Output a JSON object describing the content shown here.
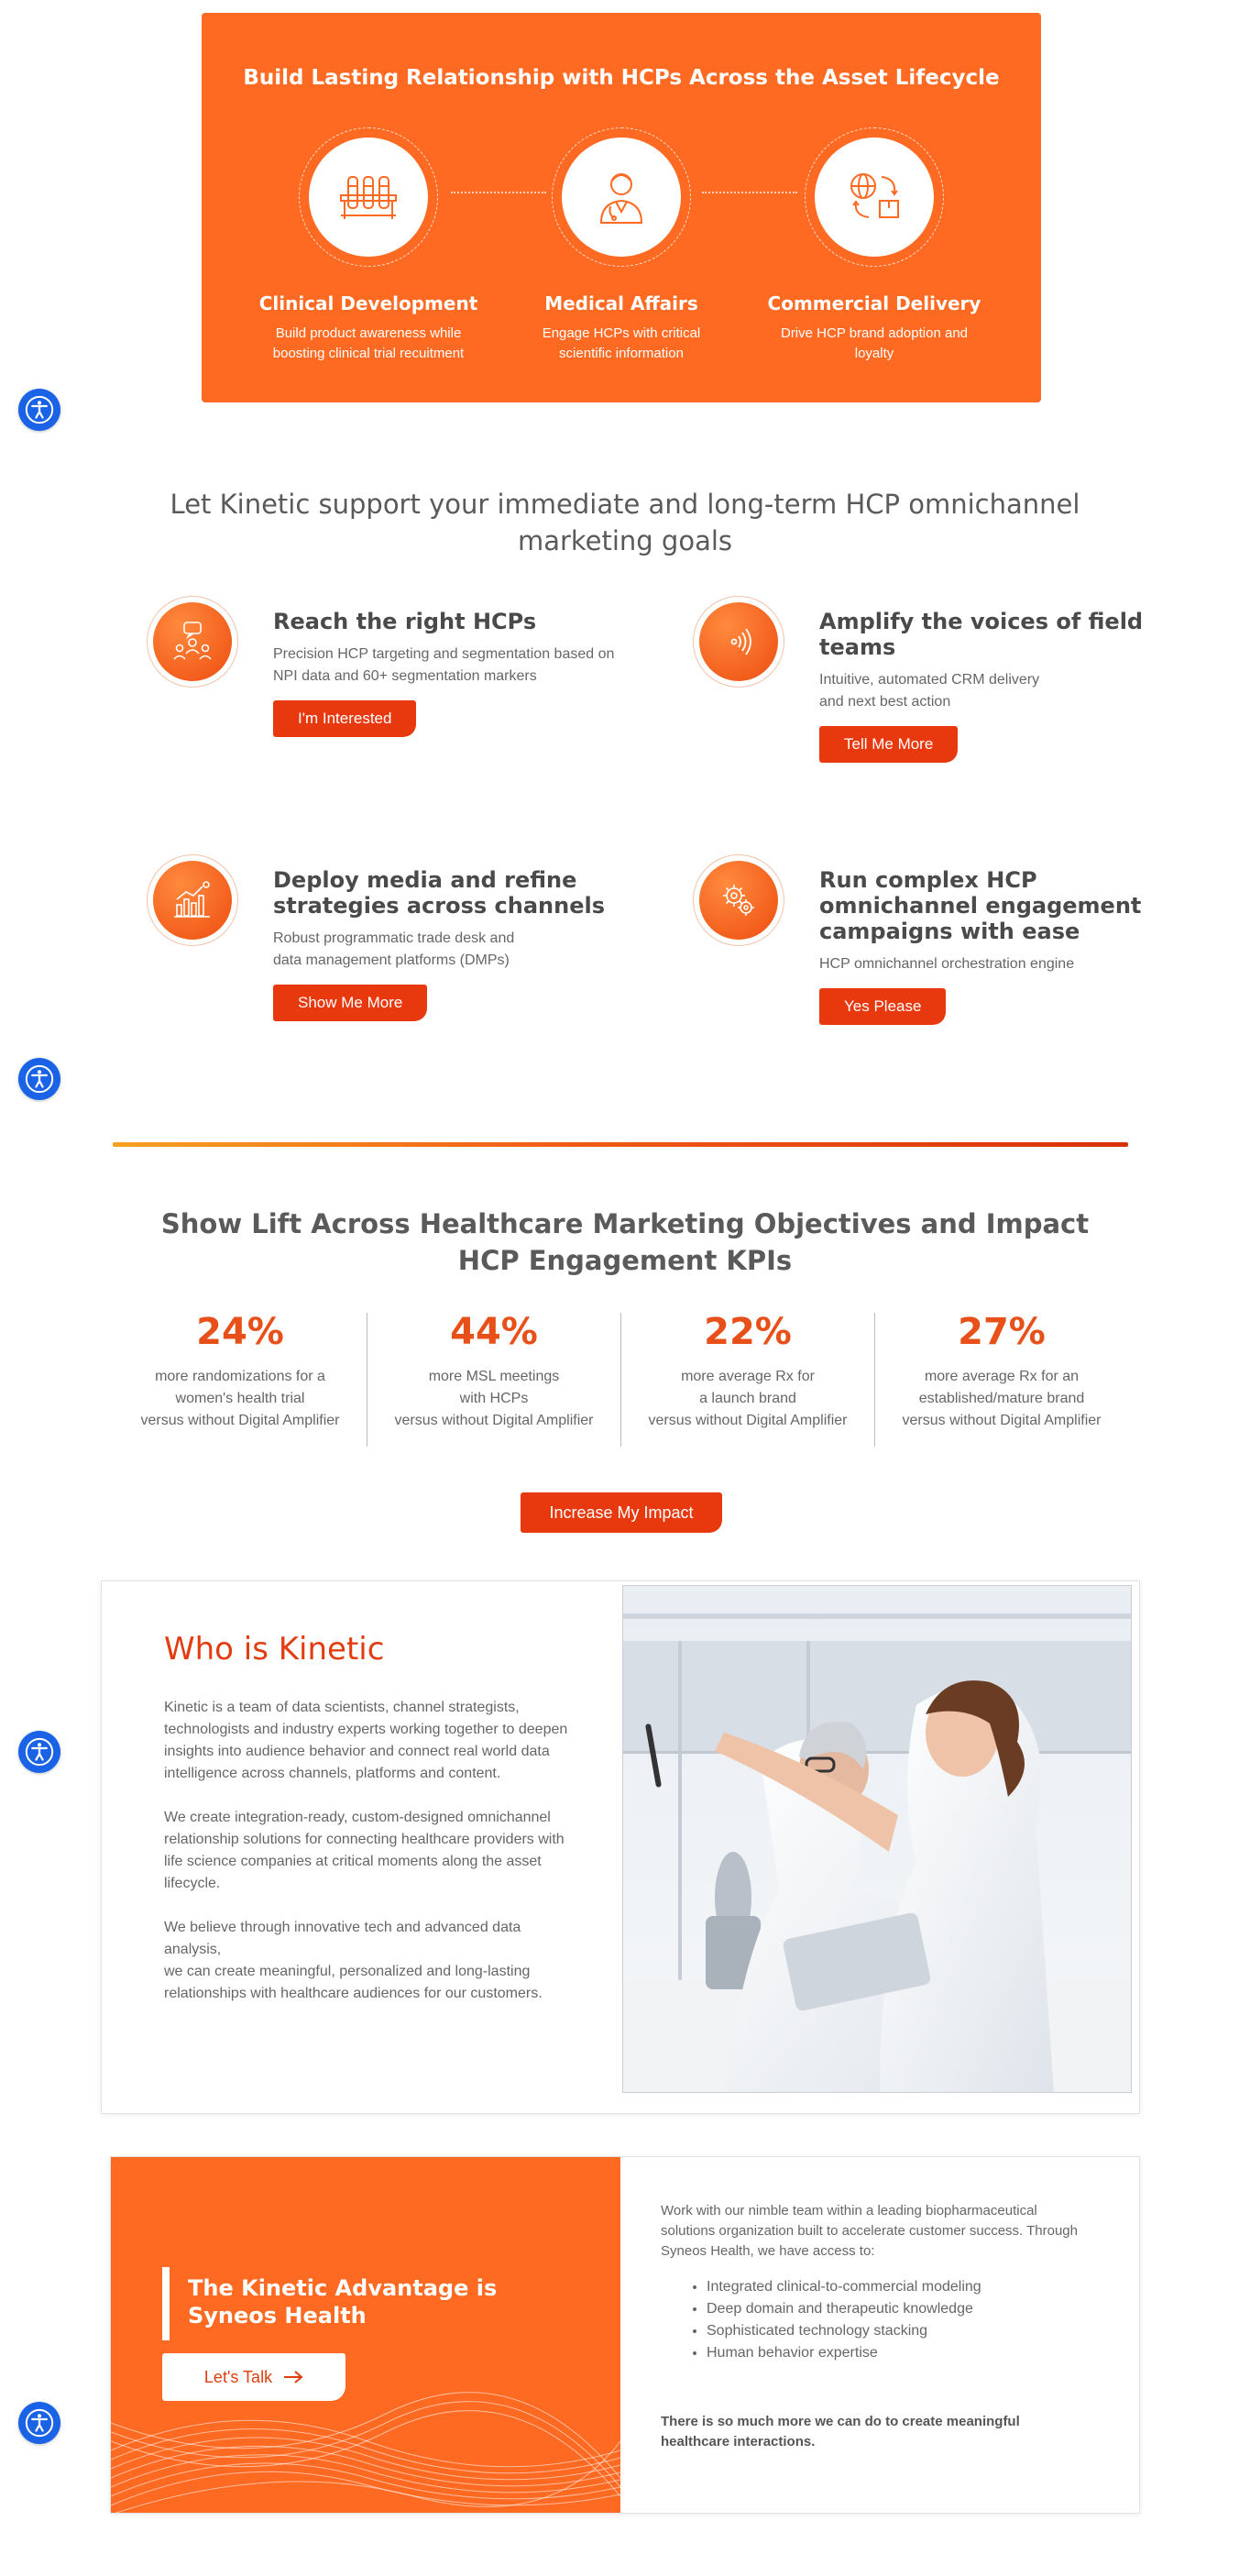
{
  "lifecycle": {
    "title": "Build Lasting Relationship with HCPs Across the Asset Lifecycle",
    "stages": [
      {
        "title": "Clinical Development",
        "text": "Build product awareness while boosting clinical trial recuitment"
      },
      {
        "title": "Medical Affairs",
        "text": "Engage HCPs with critical scientific information"
      },
      {
        "title": "Commercial Delivery",
        "text": "Drive HCP brand adoption and loyalty"
      }
    ]
  },
  "goals": {
    "title": "Let Kinetic support your immediate and long-term HCP omnichannel marketing goals",
    "features": [
      {
        "title": "Reach the right HCPs",
        "text": "Precision HCP targeting and segmentation based on\nNPI data and 60+ segmentation markers",
        "button": "I'm Interested",
        "icon": "audience-icon"
      },
      {
        "title": "Amplify the voices of field teams",
        "text": "Intuitive, automated CRM delivery\nand next best action",
        "button": "Tell Me More",
        "icon": "broadcast-icon"
      },
      {
        "title": "Deploy media and refine strategies across channels",
        "text": "Robust programmatic trade desk and\ndata management platforms (DMPs)",
        "button": "Show Me More",
        "icon": "analytics-icon"
      },
      {
        "title": "Run complex HCP omnichannel engagement campaigns with ease",
        "text": "HCP omnichannel orchestration engine",
        "button": "Yes Please",
        "icon": "gears-icon"
      }
    ]
  },
  "kpis": {
    "title": "Show Lift Across Healthcare Marketing Objectives and Impact HCP Engagement KPIs",
    "items": [
      {
        "value": "24%",
        "text": "more randomizations for a\nwomen's health trial\nversus without Digital Amplifier"
      },
      {
        "value": "44%",
        "text": "more MSL meetings\nwith HCPs\nversus without Digital Amplifier"
      },
      {
        "value": "22%",
        "text": "more average Rx for\na launch brand\nversus without Digital Amplifier"
      },
      {
        "value": "27%",
        "text": "more average Rx for an\nestablished/mature brand\nversus without Digital Amplifier"
      }
    ],
    "button": "Increase My Impact"
  },
  "who": {
    "title": "Who is Kinetic",
    "paragraphs": [
      "Kinetic is a team of data scientists, channel strategists, technologists and industry experts working together to deepen insights into audience behavior and connect real world data intelligence across channels, platforms and content.",
      "We create integration-ready, custom-designed omnichannel relationship solutions for connecting healthcare providers with life science companies at critical moments along the asset lifecycle.",
      "We believe through innovative tech and advanced data analysis,\nwe can create meaningful, personalized and long-lasting relationships with healthcare audiences for our customers."
    ]
  },
  "advantage": {
    "title": "The Kinetic Advantage is Syneos Health",
    "button": "Let's Talk",
    "intro": "Work with our nimble team within a leading biopharmaceutical solutions organization built to accelerate customer success. Through Syneos Health, we have access to:",
    "list": [
      "Integrated clinical-to-commercial modeling",
      "Deep domain and therapeutic knowledge",
      "Sophisticated technology stacking",
      "Human behavior expertise"
    ],
    "closing": "There is so much more we can do to create meaningful healthcare interactions."
  },
  "colors": {
    "brand_orange": "#ff6a23",
    "button_red": "#e8390e",
    "accessibility_blue": "#1a63e6"
  }
}
